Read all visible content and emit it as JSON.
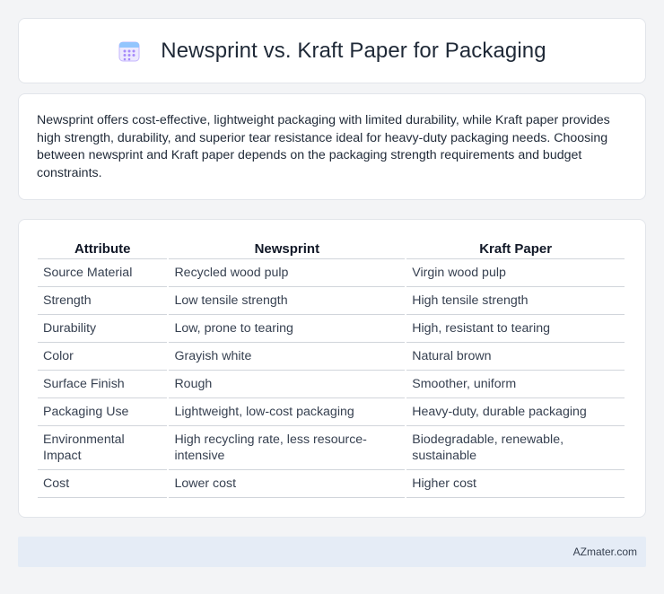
{
  "header": {
    "title": "Newsprint vs. Kraft Paper for Packaging",
    "icon": "calendar-icon"
  },
  "summary": "Newsprint offers cost-effective, lightweight packaging with limited durability, while Kraft paper provides high strength, durability, and superior tear resistance ideal for heavy-duty packaging needs. Choosing between newsprint and Kraft paper depends on the packaging strength requirements and budget constraints.",
  "table": {
    "headers": [
      "Attribute",
      "Newsprint",
      "Kraft Paper"
    ],
    "rows": [
      [
        "Source Material",
        "Recycled wood pulp",
        "Virgin wood pulp"
      ],
      [
        "Strength",
        "Low tensile strength",
        "High tensile strength"
      ],
      [
        "Durability",
        "Low, prone to tearing",
        "High, resistant to tearing"
      ],
      [
        "Color",
        "Grayish white",
        "Natural brown"
      ],
      [
        "Surface Finish",
        "Rough",
        "Smoother, uniform"
      ],
      [
        "Packaging Use",
        "Lightweight, low-cost packaging",
        "Heavy-duty, durable packaging"
      ],
      [
        "Environmental Impact",
        "High recycling rate, less resource-intensive",
        "Biodegradable, renewable, sustainable"
      ],
      [
        "Cost",
        "Lower cost",
        "Higher cost"
      ]
    ]
  },
  "footer": {
    "brand": "AZmater.com"
  },
  "colors": {
    "page_background": "#f3f4f6",
    "card_background": "#ffffff",
    "footer_background": "#e5ecf6",
    "icon_accent": "#a78bfa"
  }
}
